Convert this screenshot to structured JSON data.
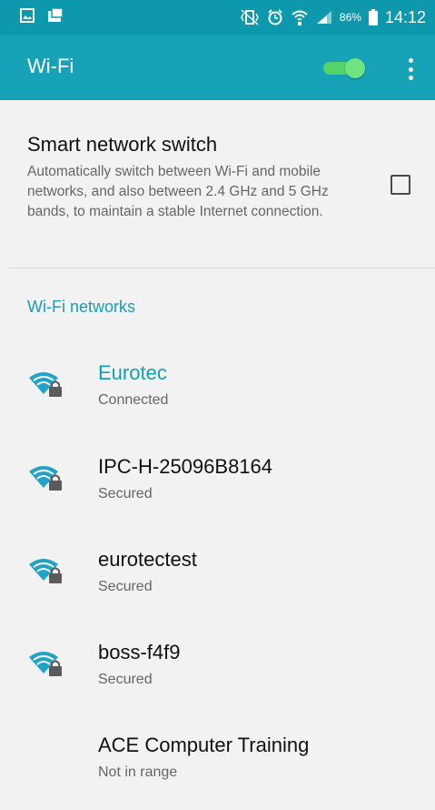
{
  "status_bar": {
    "battery_percent": "86%",
    "time": "14:12",
    "icons": [
      "gallery-icon",
      "screenshot-icon",
      "vibrate-icon",
      "alarm-icon",
      "wifi-status-icon",
      "signal-icon",
      "battery-icon"
    ]
  },
  "app_bar": {
    "title": "Wi-Fi",
    "wifi_enabled": true,
    "menu_icon": "more-vert-icon"
  },
  "smart_network_switch": {
    "title": "Smart network switch",
    "description": "Automatically switch between Wi-Fi and mobile networks, and also between 2.4 GHz and 5 GHz bands, to maintain a stable Internet connection.",
    "checked": false
  },
  "networks_section": {
    "header": "Wi-Fi networks",
    "networks": [
      {
        "name": "Eurotec",
        "status": "Connected",
        "connected": true,
        "icon": "wifi-lock-icon"
      },
      {
        "name": "IPC-H-25096B8164",
        "status": "Secured",
        "connected": false,
        "icon": "wifi-lock-icon"
      },
      {
        "name": "eurotectest",
        "status": "Secured",
        "connected": false,
        "icon": "wifi-lock-icon"
      },
      {
        "name": "boss-f4f9",
        "status": "Secured",
        "connected": false,
        "icon": "wifi-lock-icon"
      },
      {
        "name": "ACE Computer Training",
        "status": "Not in range",
        "connected": false,
        "icon": ""
      }
    ]
  },
  "colors": {
    "status_bar": "#0e98ad",
    "app_bar": "#16a2b7",
    "accent": "#14a0b5",
    "toggle_on": "#55d36b"
  }
}
